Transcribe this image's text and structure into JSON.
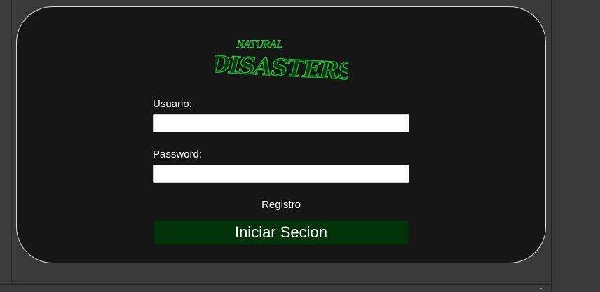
{
  "logo": {
    "line1": "NATURAL",
    "line2": "DISASTERS"
  },
  "form": {
    "username_label": "Usuario:",
    "username_value": "",
    "password_label": "Password:",
    "password_value": "",
    "register_link": "Registro",
    "submit_label": "Iniciar Secion"
  },
  "colors": {
    "panel_background": "#161616",
    "button_background": "#023208",
    "logo_green": "#1fa12e"
  }
}
